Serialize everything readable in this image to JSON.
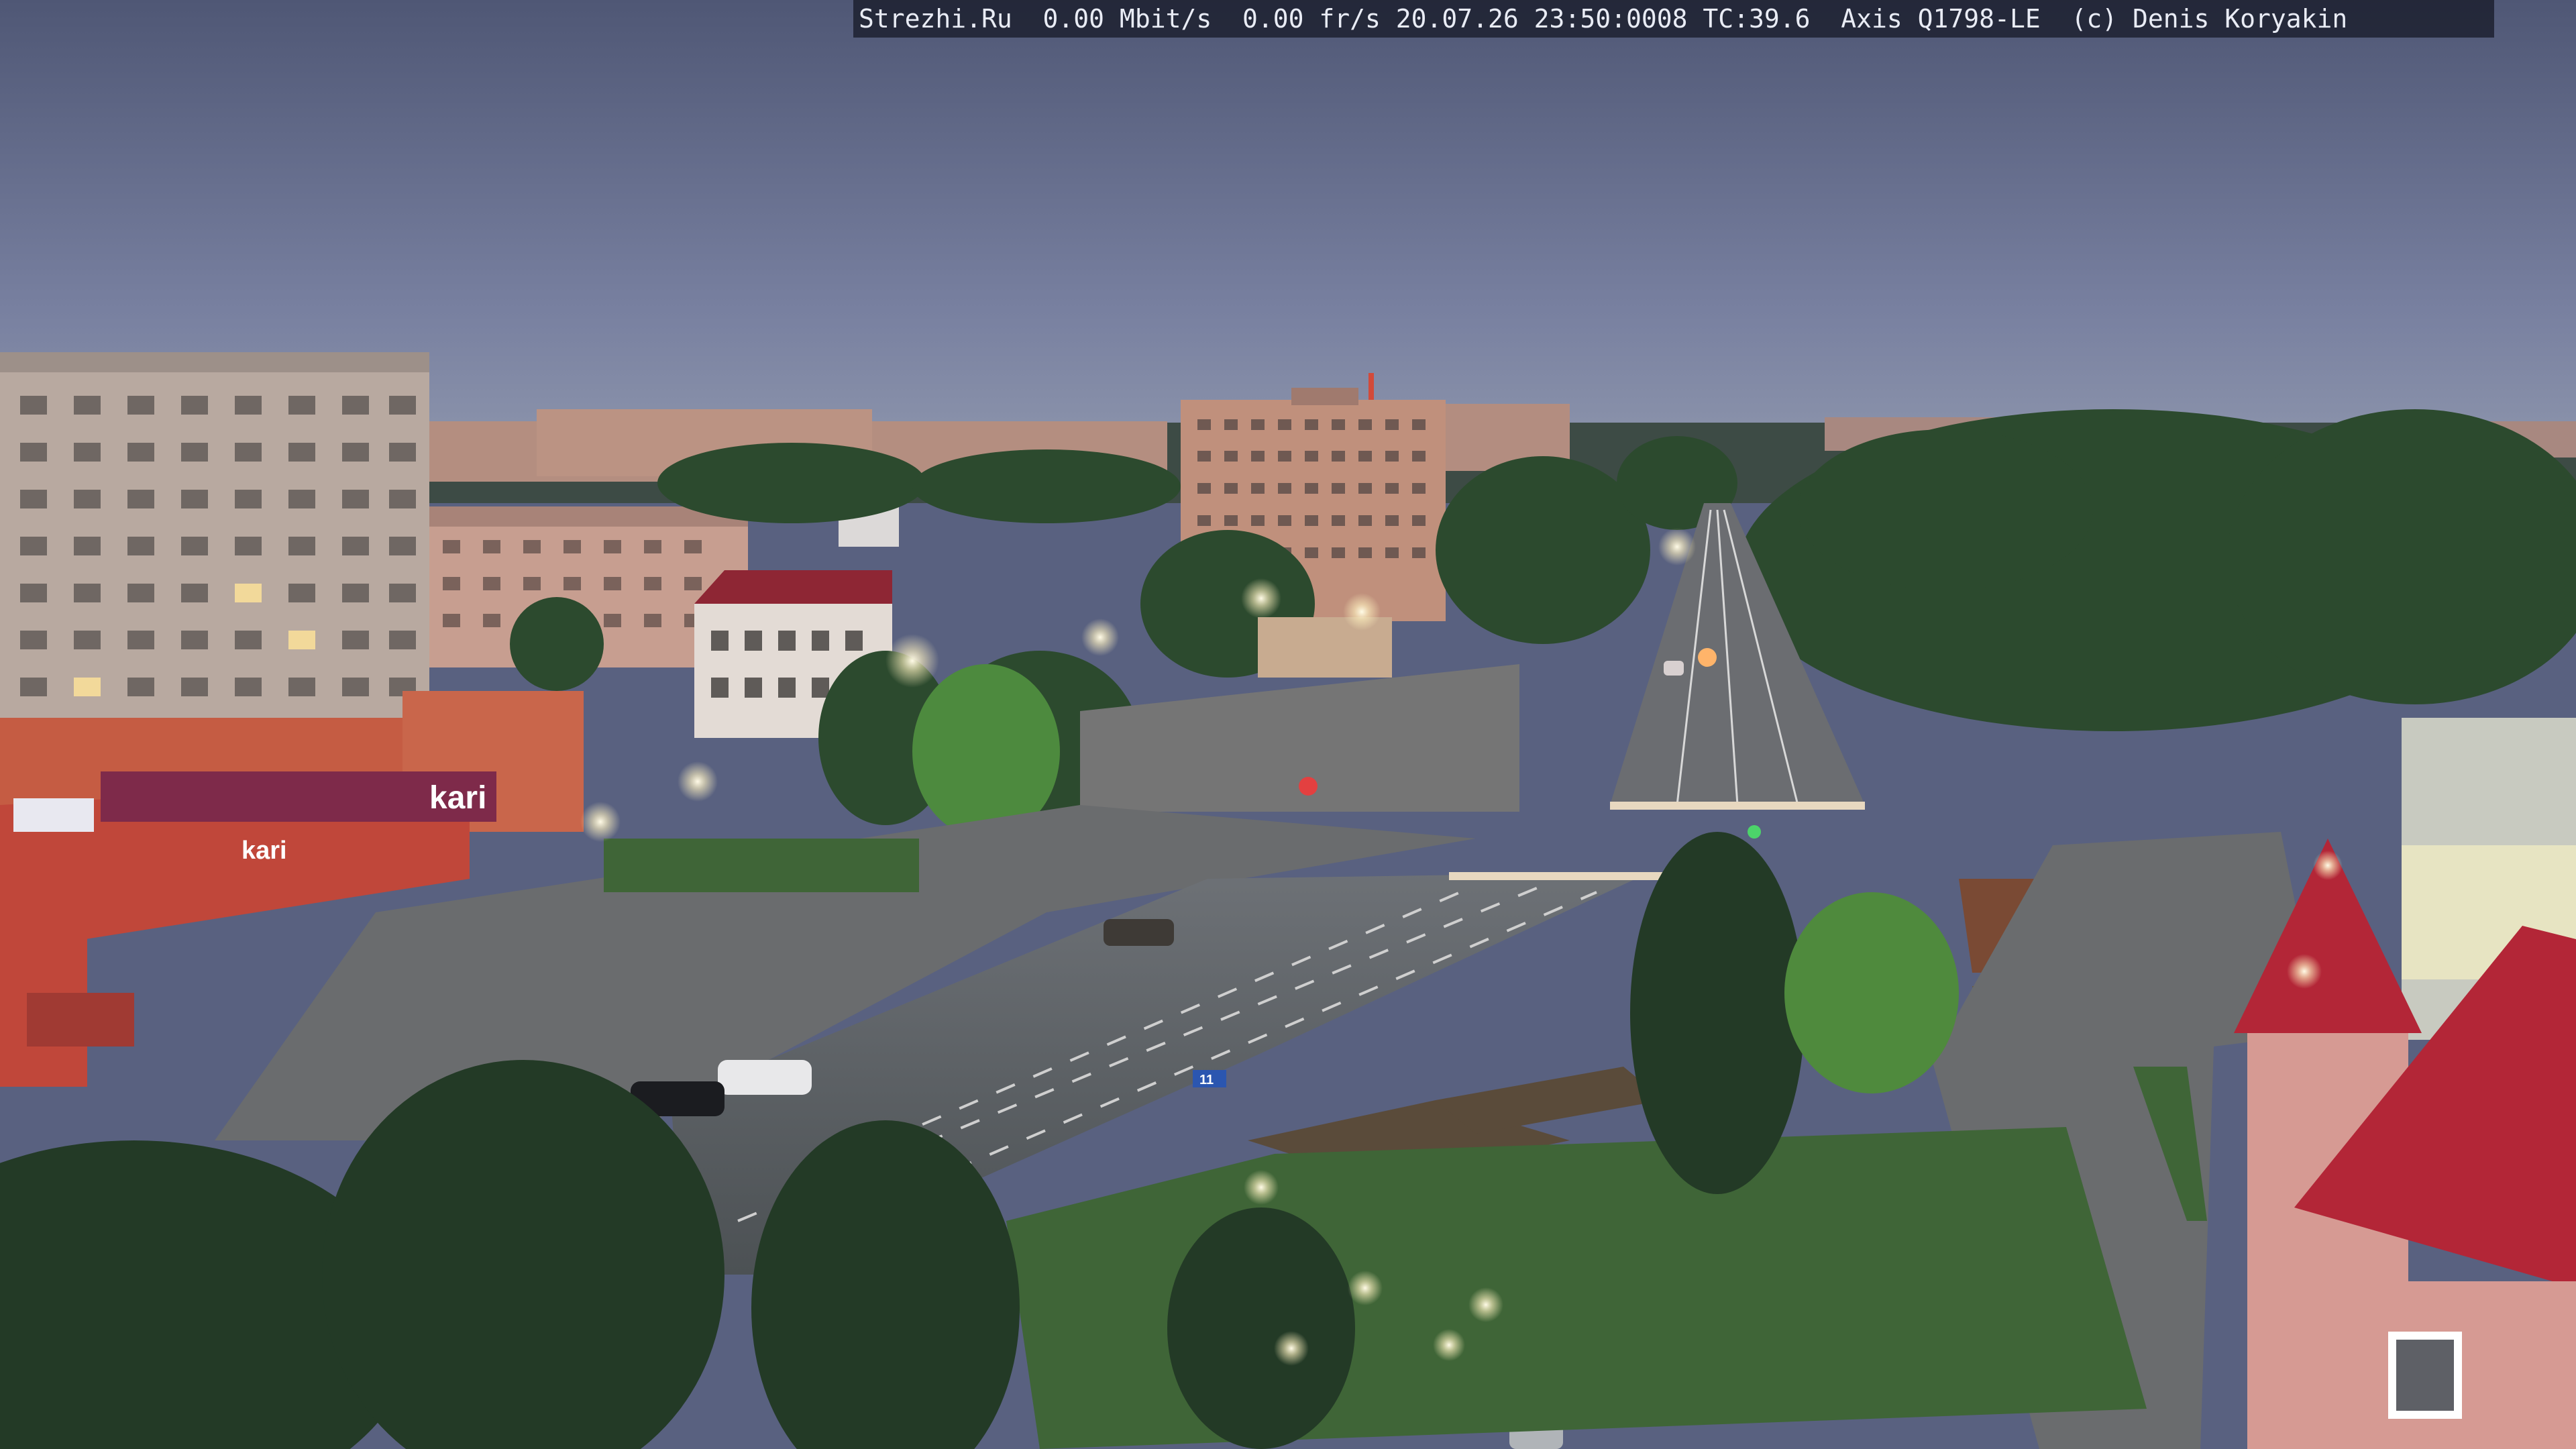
{
  "overlay": {
    "site": "Strezhi.Ru",
    "bitrate": "0.00 Mbit/s",
    "framerate": "0.00 fr/s",
    "datetime": "20.07.26 23:50:0008",
    "temperature": "TC:39.6",
    "camera": "Axis Q1798-LE",
    "copyright": "(c) Denis Koryakin"
  },
  "signs": {
    "store_logo": "kari",
    "store_logo_small": "kari",
    "road_sign": "11"
  },
  "colors": {
    "sky_top": "#4f5775",
    "sky_horizon": "#8790aa",
    "building_brick": "#c98f78",
    "store_red": "#c0473a",
    "roof_red": "#c0283a",
    "foliage": "#2c4a2e",
    "road": "#4f5558"
  }
}
